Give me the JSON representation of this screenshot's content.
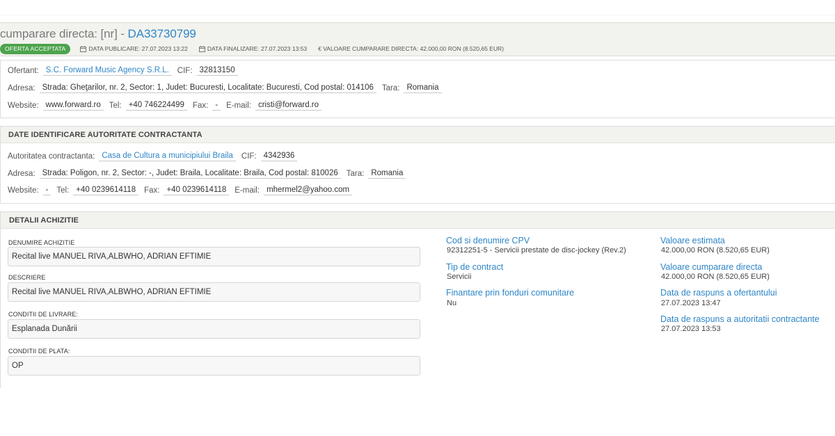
{
  "header": {
    "title_prefix": "cumparare directa: [nr]",
    "title_sep": " - ",
    "title_number": "DA33730799",
    "status_badge": "OFERTA ACCEPTATA",
    "data_publicare": "DATA PUBLICARE: 27.07.2023 13:22",
    "data_finalizare": "DATA FINALIZARE: 27.07.2023 13:53",
    "valoare": "€ VALOARE CUMPARARE DIRECTA: 42.000,00  RON (8.520,65  EUR)"
  },
  "ofertant": {
    "label_ofertant": "Ofertant:",
    "name": "S.C. Forward Music Agency S.R.L.",
    "label_cif": "CIF:",
    "cif": "32813150",
    "label_adresa": "Adresa:",
    "adresa": "Strada: Gheţarilor, nr. 2, Sector: 1, Judet: Bucuresti, Localitate: Bucuresti, Cod postal: 014106",
    "label_tara": "Tara:",
    "tara": "Romania",
    "label_website": "Website:",
    "website": "www.forward.ro",
    "label_tel": "Tel:",
    "tel": "+40 746224499",
    "label_fax": "Fax:",
    "fax": "-",
    "label_email": "E-mail:",
    "email": "cristi@forward.ro"
  },
  "autoritate": {
    "section_title": "DATE IDENTIFICARE AUTORITATE CONTRACTANTA",
    "label_autoritate": "Autoritatea contractanta:",
    "name": "Casa de Cultura a municipiului Braila",
    "label_cif": "CIF:",
    "cif": "4342936",
    "label_adresa": "Adresa:",
    "adresa": "Strada: Poligon, nr. 2, Sector: -, Judet: Braila, Localitate: Braila, Cod postal: 810026",
    "label_tara": "Tara:",
    "tara": "Romania",
    "label_website": "Website:",
    "website": "-",
    "label_tel": "Tel:",
    "tel": "+40 0239614118",
    "label_fax": "Fax:",
    "fax": "+40 0239614118",
    "label_email": "E-mail:",
    "email": "mhermel2@yahoo.com"
  },
  "achizitie": {
    "section_title": "DETALII ACHIZITIE",
    "denumire_label": "DENUMIRE ACHIZITIE",
    "denumire": "Recital live MANUEL RIVA,ALBWHO, ADRIAN EFTIMIE",
    "descriere_label": "DESCRIERE",
    "descriere": "Recital live MANUEL RIVA,ALBWHO, ADRIAN EFTIMIE",
    "livrare_label": "CONDITII DE LIVRARE:",
    "livrare": "Esplanada Dunării",
    "plata_label": "CONDITII DE PLATA:",
    "plata": "OP",
    "cpv_title": "Cod si denumire CPV",
    "cpv_value": "92312251-5 - Servicii prestate de disc-jockey (Rev.2)",
    "tip_title": "Tip de contract",
    "tip_value": "Servicii",
    "finantare_title": "Finantare prin fonduri comunitare",
    "finantare_value": "Nu",
    "val_estimata_title": "Valoare estimata",
    "val_estimata_value": "42.000,00  RON (8.520,65  EUR)",
    "val_directa_title": "Valoare cumparare directa",
    "val_directa_value": "42.000,00  RON (8.520,65  EUR)",
    "raspuns_ofertant_title": "Data de raspuns a ofertantului",
    "raspuns_ofertant_value": "27.07.2023 13:47",
    "raspuns_autoritate_title": "Data de raspuns a autoritatii contractante",
    "raspuns_autoritate_value": "27.07.2023 13:53"
  },
  "colors": {
    "accent": "#2e86c7",
    "badge": "#4da34d",
    "header_bg": "#f2f2ee"
  }
}
